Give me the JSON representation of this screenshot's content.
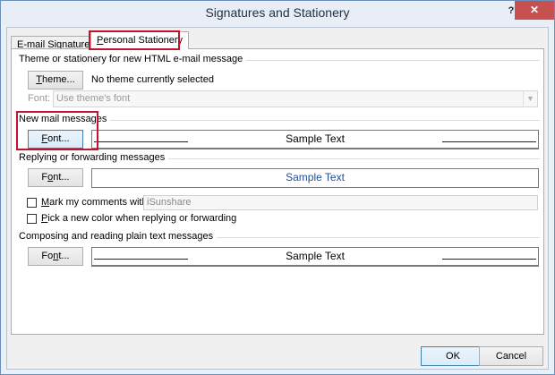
{
  "window": {
    "title": "Signatures and Stationery",
    "help_label": "?",
    "close_label": "✕"
  },
  "tabs": [
    {
      "label_pre": "",
      "label_key": "E",
      "label_post": "-mail Signature"
    },
    {
      "label_pre": "",
      "label_key": "P",
      "label_post": "ersonal Stationery"
    }
  ],
  "theme_group": {
    "title": "Theme or stationery for new HTML e-mail message",
    "theme_button": {
      "pre": "",
      "key": "T",
      "post": "heme..."
    },
    "theme_status": "No theme currently selected",
    "font_label": "Font:",
    "font_select_value": "Use theme's font"
  },
  "new_mail": {
    "title": "New mail messages",
    "font_button": {
      "pre": "",
      "key": "F",
      "post": "ont..."
    },
    "sample": "Sample Text"
  },
  "reply": {
    "title": "Replying or forwarding messages",
    "font_button": {
      "pre": "F",
      "key": "o",
      "post": "nt..."
    },
    "sample": "Sample Text",
    "mark_comments": {
      "pre": "",
      "key": "M",
      "post": "ark my comments with:"
    },
    "mark_value": "iSunshare",
    "pick_color": {
      "pre": "",
      "key": "P",
      "post": "ick a new color when replying or forwarding"
    }
  },
  "plain_text": {
    "title": "Composing and reading plain text messages",
    "font_button": {
      "pre": "Fo",
      "key": "n",
      "post": "t..."
    },
    "sample": "Sample Text"
  },
  "footer": {
    "ok_label": "OK",
    "cancel_label": "Cancel"
  },
  "colors": {
    "highlight": "#c0152f",
    "sample_blue": "#1f4e92",
    "close_red": "#c75050"
  }
}
